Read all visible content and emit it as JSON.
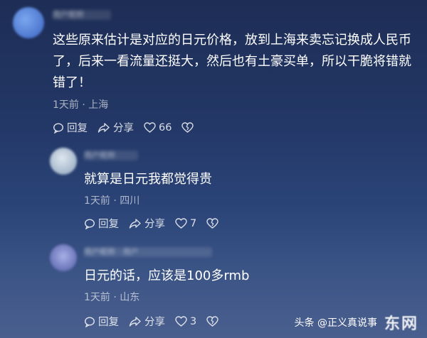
{
  "comments": [
    {
      "username": "用户昵称",
      "text": "这些原来估计是对应的日元价格，放到上海来卖忘记换成人民币了，后来一看流量还挺大，然后也有土豪买单，所以干脆将错就错了！",
      "time": "1天前",
      "location": "上海",
      "reply_label": "回复",
      "share_label": "分享",
      "likes": "66",
      "avatar_color": "#4d7fd8"
    },
    {
      "username": "用户昵称",
      "text": "就算是日元我都觉得贵",
      "time": "1天前",
      "location": "四川",
      "reply_label": "回复",
      "share_label": "分享",
      "likes": "7",
      "avatar_color": "#b8c8d8"
    },
    {
      "username": "用户昵称 · 用户",
      "text": "日元的话，应该是100多rmb",
      "time": "1天前",
      "location": "山东",
      "reply_label": "回复",
      "share_label": "分享",
      "likes": "3",
      "avatar_color": "#7c86c4"
    }
  ],
  "watermark": {
    "text": "头条 @正义真说事",
    "logo": "东网"
  }
}
